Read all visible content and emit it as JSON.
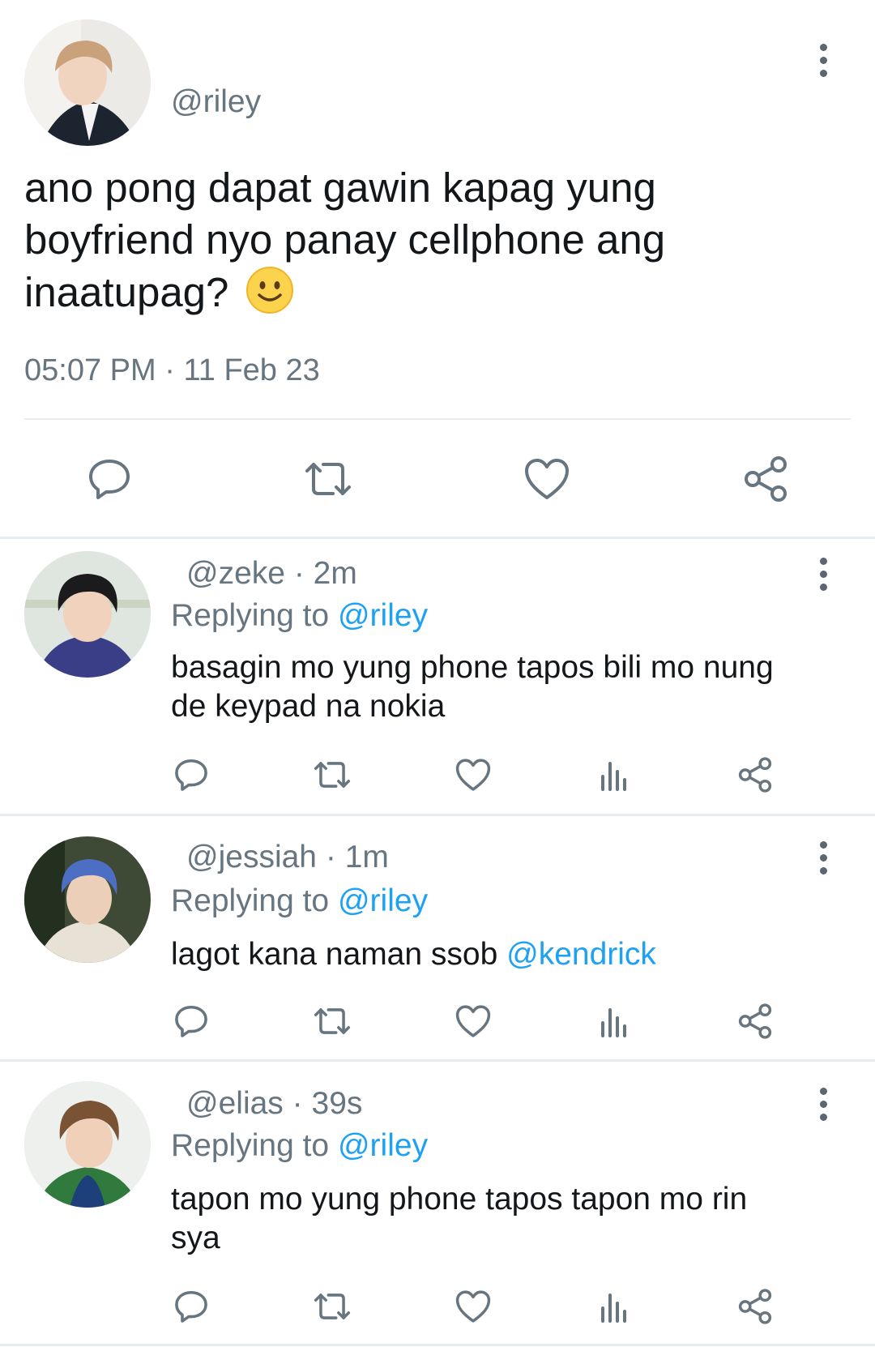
{
  "main_tweet": {
    "handle": "@riley",
    "text": "ano pong dapat gawin kapag yung boyfriend nyo panay cellphone ang inaatupag?",
    "emoji": "🙂",
    "time": "05:07 PM",
    "sep": "·",
    "date": "11 Feb 23",
    "actions": [
      "reply-icon",
      "retweet-icon",
      "like-icon",
      "share-icon"
    ]
  },
  "replies": [
    {
      "handle": "@zeke",
      "age": "2m",
      "replying_prefix": "Replying to",
      "replying_to": "@riley",
      "text_line1": "basagin mo yung phone tapos bili mo nung",
      "text_line2": "de keypad na nokia",
      "mention": ""
    },
    {
      "handle": "@jessiah",
      "age": "1m",
      "replying_prefix": "Replying to",
      "replying_to": "@riley",
      "text_line1": "lagot kana naman ssob",
      "text_line2": "",
      "mention": "@kendrick"
    },
    {
      "handle": "@elias",
      "age": "39s",
      "replying_prefix": "Replying to",
      "replying_to": "@riley",
      "text_line1": "tapon mo yung phone tapos tapon mo rin",
      "text_line2": "sya",
      "mention": ""
    }
  ],
  "reply_actions": [
    "reply-icon",
    "retweet-icon",
    "like-icon",
    "analytics-icon",
    "share-icon"
  ],
  "colors": {
    "link": "#1da1f2",
    "secondary": "#66757f",
    "divider": "#e6ecf0",
    "text": "#14171a"
  }
}
